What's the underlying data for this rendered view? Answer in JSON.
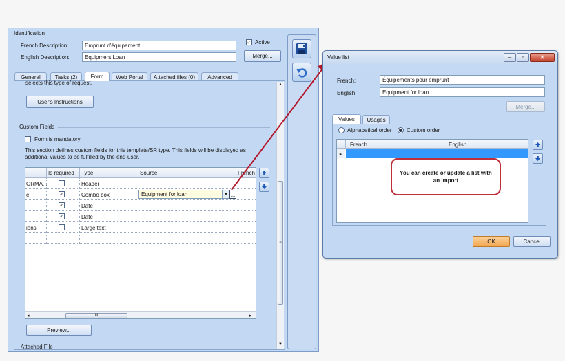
{
  "identification": {
    "title": "Identification",
    "french_label": "French Description:",
    "french_value": "Emprunt d'équipement",
    "english_label": "English Description:",
    "english_value": "Equipment Loan",
    "active_label": "Active",
    "active_checked": true,
    "merge_button": "Merge..."
  },
  "tabs": [
    {
      "label": "General"
    },
    {
      "label": "Tasks (2)"
    },
    {
      "label": "Form",
      "active": true
    },
    {
      "label": "Web Portal"
    },
    {
      "label": "Attached files (0)"
    },
    {
      "label": "Advanced"
    }
  ],
  "form": {
    "intro_text": "selects this type of request.",
    "instructions_button": "User's Instructions",
    "custom_fields_title": "Custom Fields",
    "mandatory_label": "Form is mandatory",
    "description": "This section defines custom fields for this template/SR type. This fields will be displayed as additional values to be fulfilled by the end-user.",
    "grid": {
      "columns": [
        "",
        "Is required",
        "Type",
        "Source",
        "French"
      ],
      "rows": [
        {
          "name": "ORMA...",
          "required": false,
          "type": "Header",
          "source": ""
        },
        {
          "name": "e",
          "required": true,
          "type": "Combo box",
          "source": "Equipment for loan"
        },
        {
          "name": "",
          "required": true,
          "type": "Date",
          "source": ""
        },
        {
          "name": "",
          "required": true,
          "type": "Date",
          "source": ""
        },
        {
          "name": "ions",
          "required": false,
          "type": "Large text",
          "source": ""
        },
        {
          "name": "",
          "required": false,
          "type": "",
          "source": ""
        }
      ],
      "scroll_grip": "III",
      "dropdown_ellipsis": "..."
    },
    "preview_button": "Preview...",
    "attached_file_label": "Attached File"
  },
  "toolbar": {
    "icons": [
      "save-icon",
      "undo-icon"
    ]
  },
  "value_list": {
    "title": "Value list",
    "french_label": "French:",
    "french_value": "Équipements pour emprunt",
    "english_label": "English:",
    "english_value": "Equipment for loan",
    "merge_button": "Merge...",
    "tabs": [
      {
        "label": "Values",
        "active": true
      },
      {
        "label": "Usages"
      }
    ],
    "sort_alpha": "Alphabetical order",
    "sort_custom": "Custom order",
    "sort_selected": "custom",
    "columns": [
      "French",
      "English"
    ],
    "ok_button": "OK",
    "cancel_button": "Cancel"
  },
  "callout_text": "You can create or update a list with an import",
  "colors": {
    "panel": "#c3d8f2",
    "accent_arrow": "#b3162a",
    "selection": "#3399ff",
    "ok_button": "#f6b46b"
  }
}
